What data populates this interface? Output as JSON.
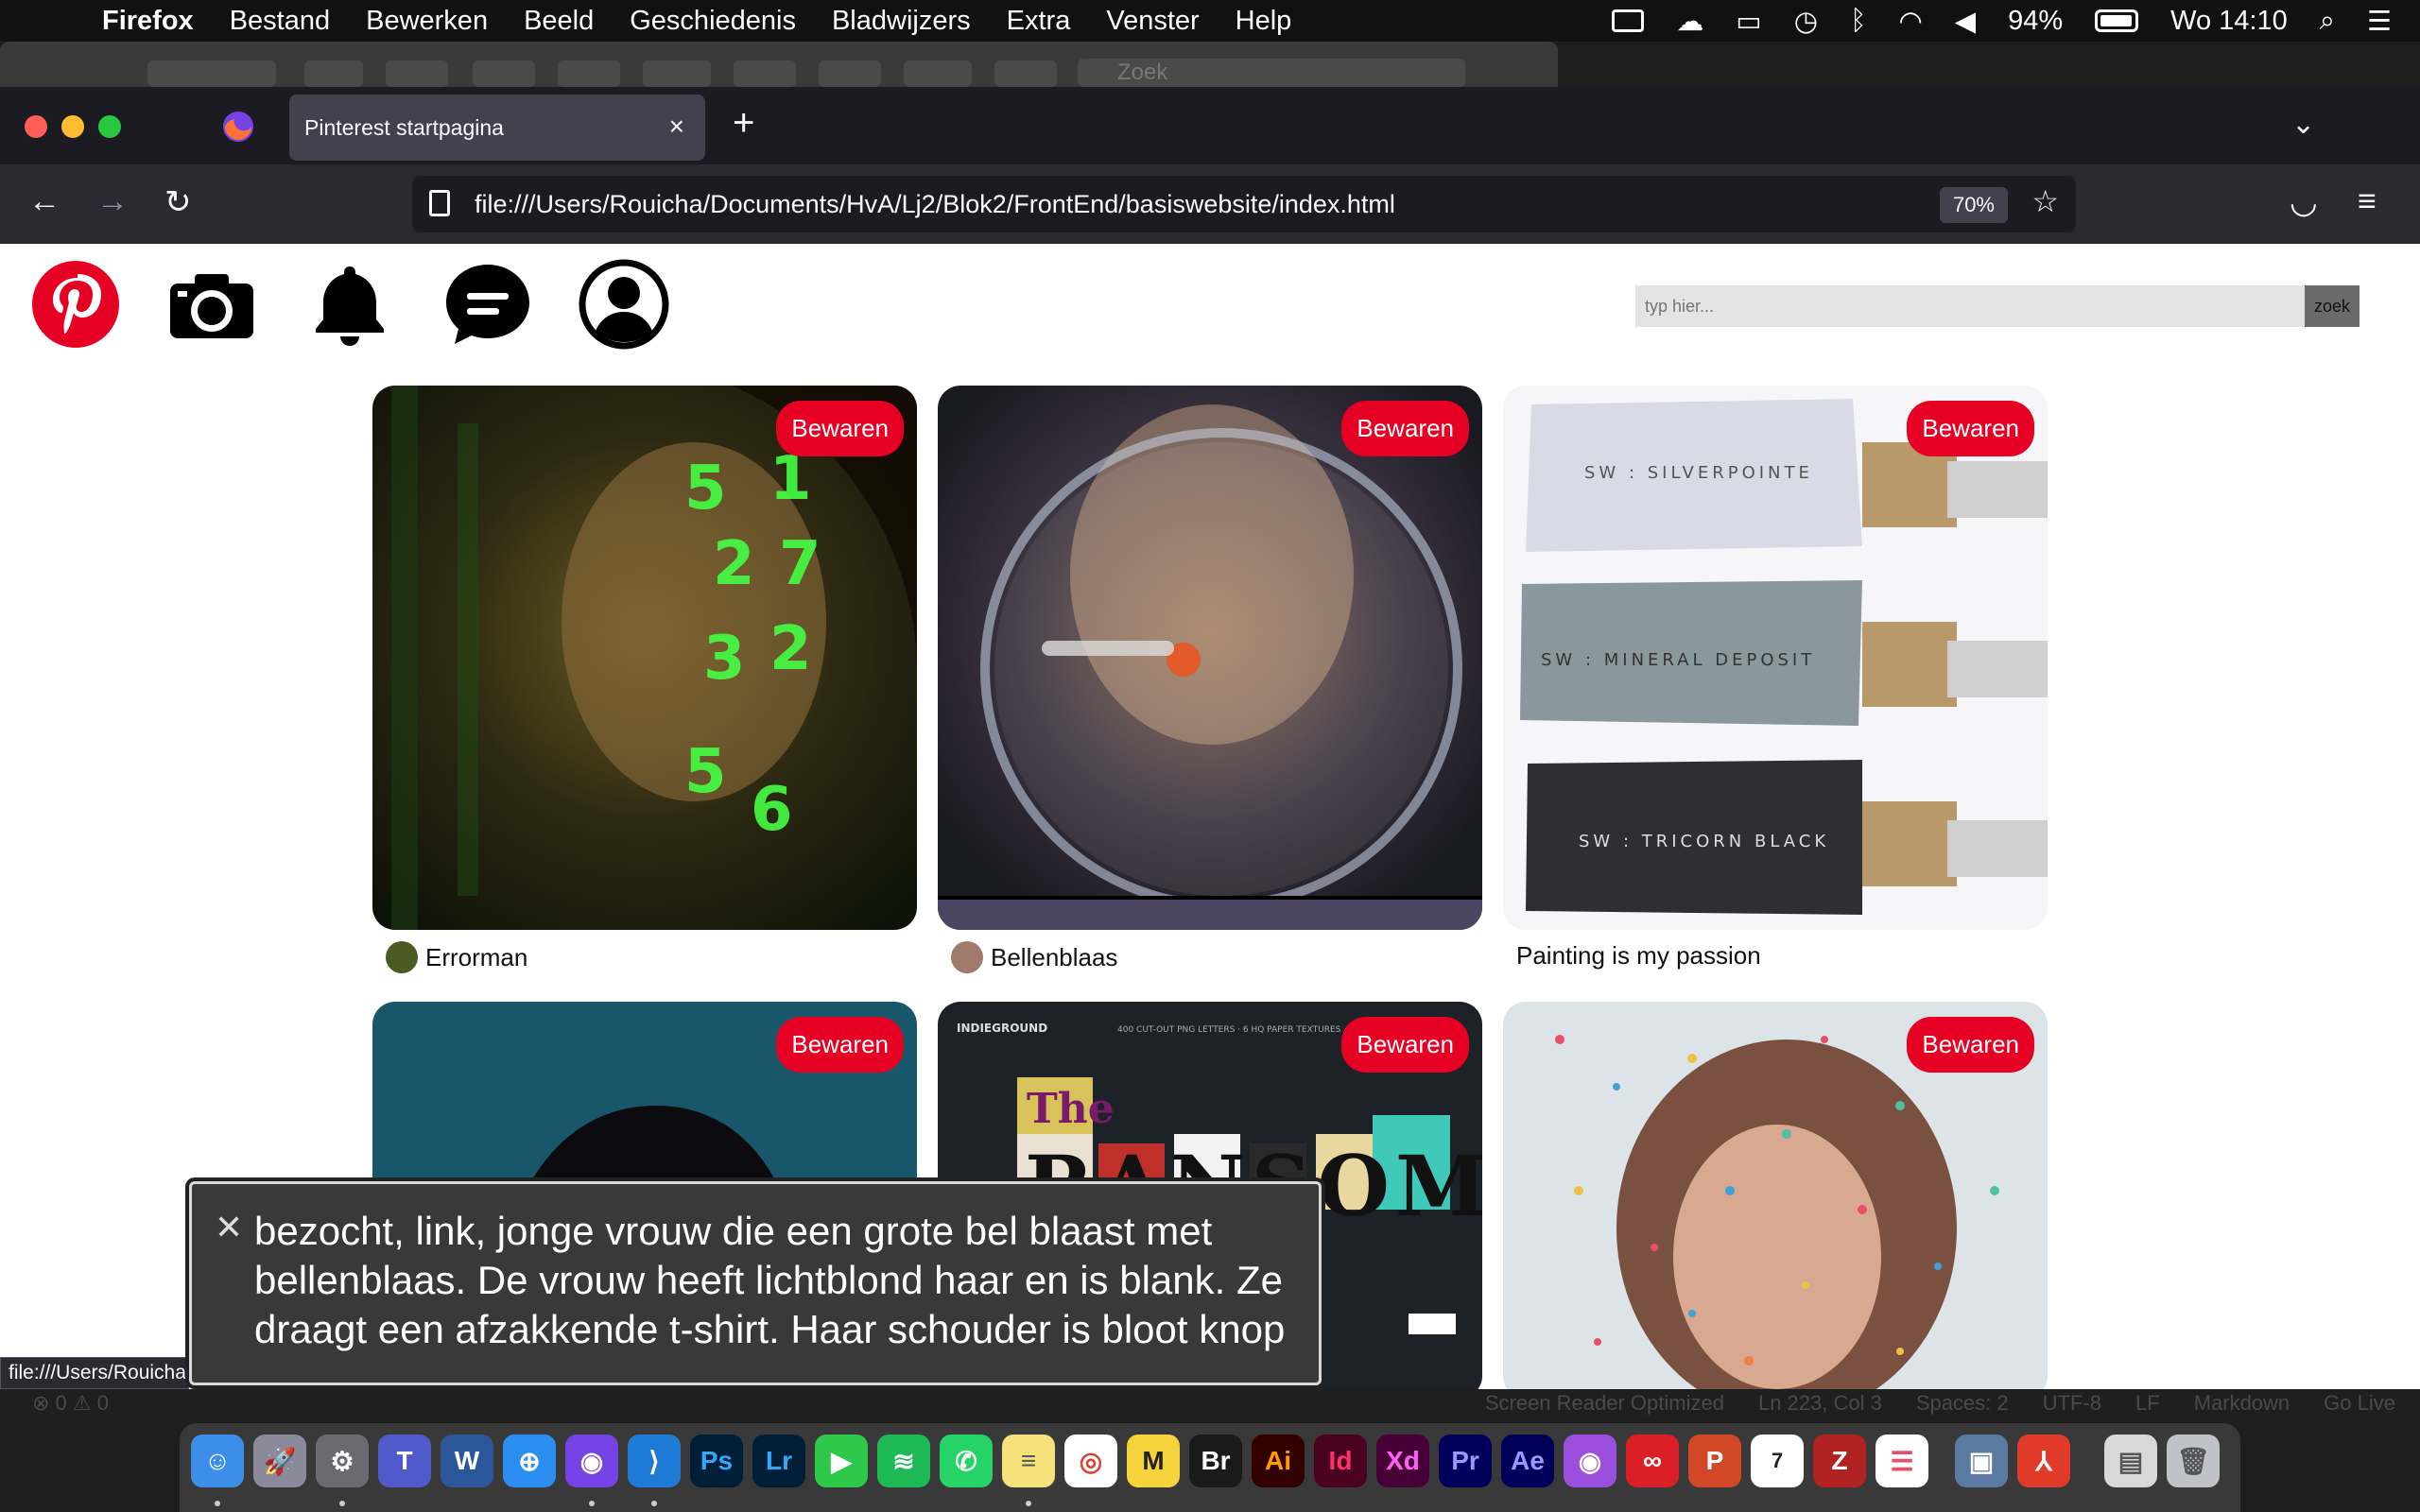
{
  "menubar": {
    "app": "Firefox",
    "items": [
      "Bestand",
      "Bewerken",
      "Beeld",
      "Geschiedenis",
      "Bladwijzers",
      "Extra",
      "Venster",
      "Help"
    ],
    "battery": "94%",
    "clock": "Wo 14:10"
  },
  "bg_window": {
    "search_placeholder": "Zoek"
  },
  "browser": {
    "tab_title": "Pinterest startpagina",
    "url": "file:///Users/Rouicha/Documents/HvA/Lj2/Blok2/FrontEnd/basiswebsite/index.html",
    "zoom": "70%",
    "status_url": "file:///Users/Rouicha/Documents/HvA/Lj2/Blok2/FrontEnd/basiswebsite/index.html"
  },
  "page": {
    "search_placeholder": "typ hier...",
    "search_button": "zoek",
    "save_label": "Bewaren",
    "pins": [
      {
        "caption": "Errorman"
      },
      {
        "caption": "Bellenblaas"
      },
      {
        "caption": "Painting is my passion"
      }
    ],
    "paint_labels": [
      "SW : SILVERPOINTE",
      "SW : MINERAL DEPOSIT",
      "SW : TRICORN BLACK"
    ],
    "ransom": {
      "brand": "INDIEGROUND",
      "subtitle": "400 CUT-OUT PNG LETTERS · 6 HQ PAPER TEXTURES",
      "title_word": "The",
      "title": "RANSOM"
    }
  },
  "voiceover": {
    "text": "bezocht, link, jonge vrouw die een grote bel blaast met bellenblaas. De vrouw heeft lichtblond haar en is blank. Ze draagt een afzakkende t-shirt. Haar schouder is bloot knop"
  },
  "vscode_status": {
    "problems": "⊗ 0 ⚠ 0",
    "items": [
      "Screen Reader Optimized",
      "Ln 223, Col 3",
      "Spaces: 2",
      "UTF-8",
      "LF",
      "Markdown",
      "Go Live"
    ]
  },
  "dock": [
    "Ps",
    "Lr",
    "Br",
    "Ai",
    "Id",
    "Xd",
    "Pr",
    "Ae"
  ]
}
